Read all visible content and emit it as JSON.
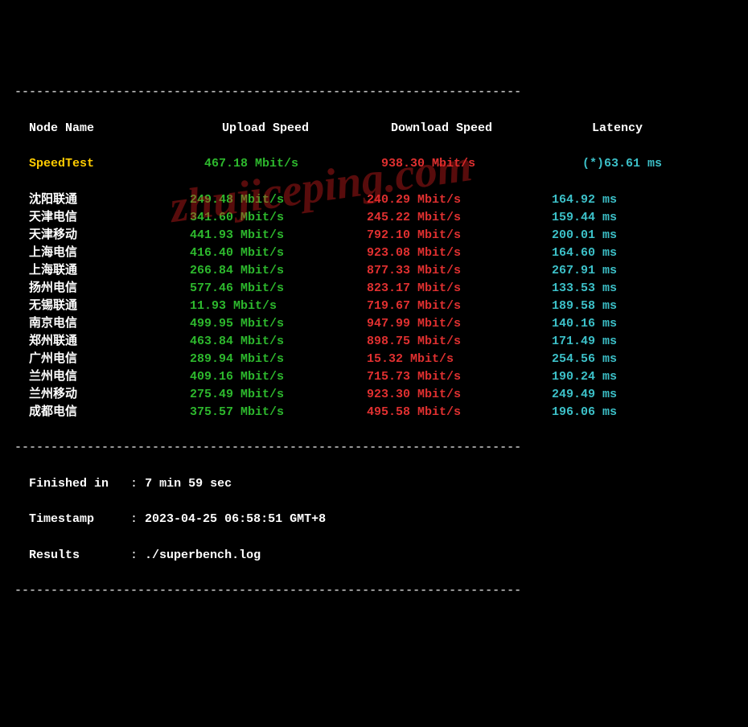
{
  "dashline": "----------------------------------------------------------------------",
  "header": {
    "node": "Node Name",
    "upload": "Upload Speed",
    "download": "Download Speed",
    "latency": "Latency"
  },
  "speedtest": {
    "name": "SpeedTest",
    "upload": "467.18 Mbit/s",
    "download": "938.30 Mbit/s",
    "latency": "(*)63.61 ms"
  },
  "rows": [
    {
      "name": "沈阳联通",
      "upload": "249.48 Mbit/s",
      "download": "240.29 Mbit/s",
      "latency": "164.92 ms"
    },
    {
      "name": "天津电信",
      "upload": "341.60 Mbit/s",
      "download": "245.22 Mbit/s",
      "latency": "159.44 ms"
    },
    {
      "name": "天津移动",
      "upload": "441.93 Mbit/s",
      "download": "792.10 Mbit/s",
      "latency": "200.01 ms"
    },
    {
      "name": "上海电信",
      "upload": "416.40 Mbit/s",
      "download": "923.08 Mbit/s",
      "latency": "164.60 ms"
    },
    {
      "name": "上海联通",
      "upload": "266.84 Mbit/s",
      "download": "877.33 Mbit/s",
      "latency": "267.91 ms"
    },
    {
      "name": "扬州电信",
      "upload": "577.46 Mbit/s",
      "download": "823.17 Mbit/s",
      "latency": "133.53 ms"
    },
    {
      "name": "无锡联通",
      "upload": "11.93 Mbit/s",
      "download": "719.67 Mbit/s",
      "latency": "189.58 ms"
    },
    {
      "name": "南京电信",
      "upload": "499.95 Mbit/s",
      "download": "947.99 Mbit/s",
      "latency": "140.16 ms"
    },
    {
      "name": "郑州联通",
      "upload": "463.84 Mbit/s",
      "download": "898.75 Mbit/s",
      "latency": "171.49 ms"
    },
    {
      "name": "广州电信",
      "upload": "289.94 Mbit/s",
      "download": "15.32 Mbit/s",
      "latency": "254.56 ms"
    },
    {
      "name": "兰州电信",
      "upload": "409.16 Mbit/s",
      "download": "715.73 Mbit/s",
      "latency": "190.24 ms"
    },
    {
      "name": "兰州移动",
      "upload": "275.49 Mbit/s",
      "download": "923.30 Mbit/s",
      "latency": "249.49 ms"
    },
    {
      "name": "成都电信",
      "upload": "375.57 Mbit/s",
      "download": "495.58 Mbit/s",
      "latency": "196.06 ms"
    }
  ],
  "footer": {
    "finished_label": "Finished in",
    "finished_value": "7 min 59 sec",
    "timestamp_label": "Timestamp",
    "timestamp_value": "2023-04-25 06:58:51 GMT+8",
    "results_label": "Results",
    "results_value": "./superbench.log"
  },
  "watermark": "zhujiceping.com"
}
